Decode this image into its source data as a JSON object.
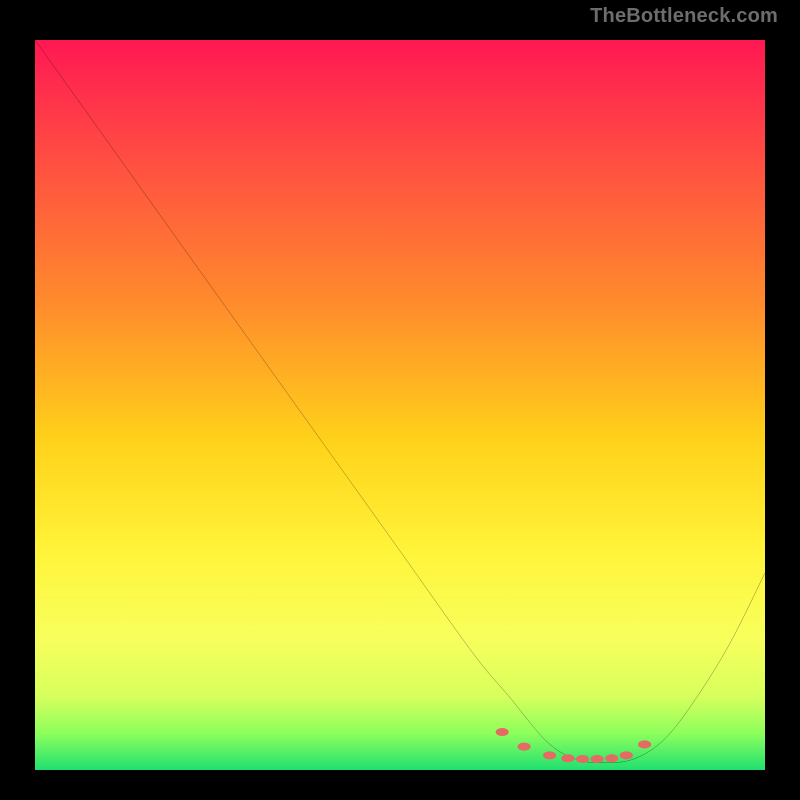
{
  "watermark": "TheBottleneck.com",
  "chart_data": {
    "type": "line",
    "title": "",
    "xlabel": "",
    "ylabel": "",
    "xlim": [
      0,
      100
    ],
    "ylim": [
      0,
      100
    ],
    "grid": false,
    "legend": null,
    "series": [
      {
        "name": "bottleneck-curve",
        "x": [
          0,
          10,
          20,
          30,
          40,
          50,
          60,
          65,
          70,
          74,
          78,
          82,
          86,
          90,
          95,
          100
        ],
        "y": [
          100,
          86,
          72,
          58,
          44,
          30,
          16,
          10,
          4,
          1.5,
          1,
          1.5,
          4,
          9,
          17,
          27
        ]
      }
    ],
    "markers": {
      "name": "highlight-dots",
      "color": "#e46a63",
      "x": [
        64,
        67,
        70.5,
        73,
        75,
        77,
        79,
        81,
        83.5
      ],
      "y": [
        5.2,
        3.2,
        2.0,
        1.6,
        1.5,
        1.5,
        1.6,
        2.0,
        3.5
      ]
    },
    "notes": "Axes, ticks, and numeric labels are not rendered in the image; values above are estimated on a 0-100 normalized scale from pixel positions."
  }
}
